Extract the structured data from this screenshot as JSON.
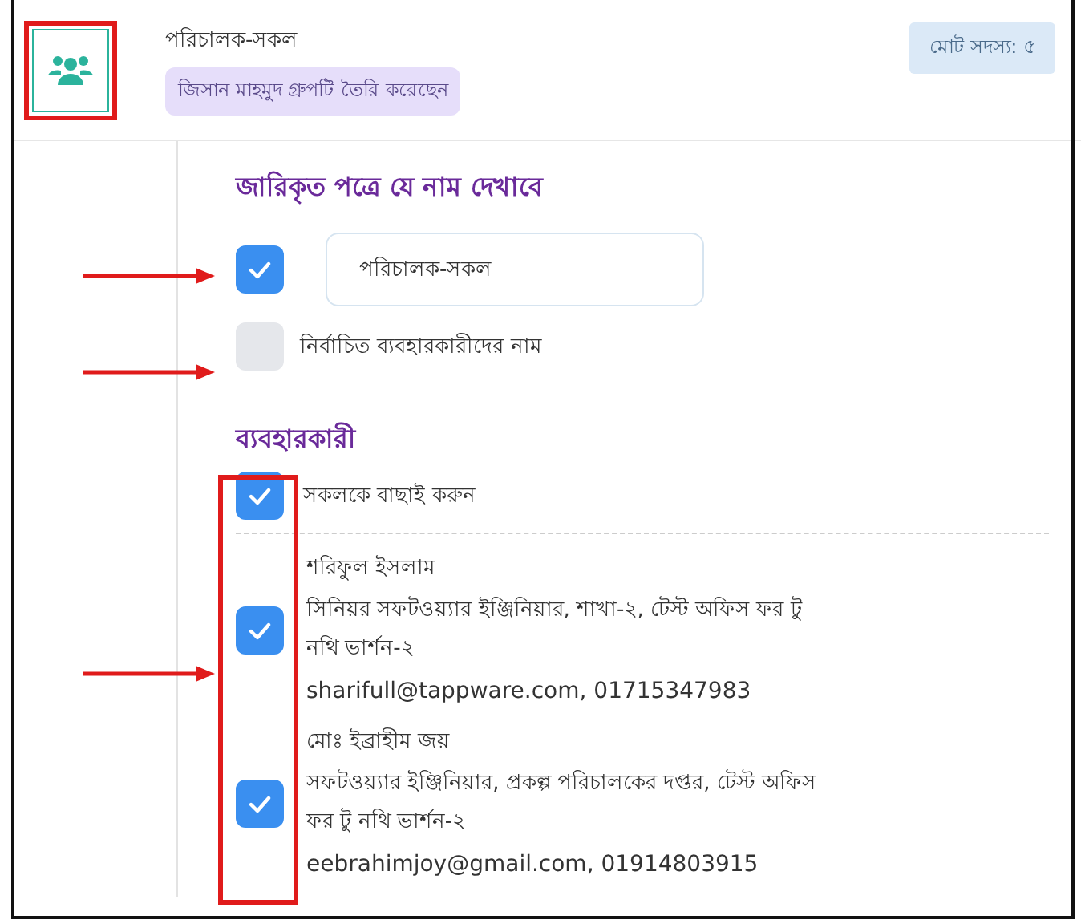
{
  "group": {
    "title": "পরিচালক-সকল",
    "created_by": "জিসান মাহমুদ গ্রুপটি তৈরি করেছেন",
    "member_count": "মোট সদস্য: ৫"
  },
  "display_name": {
    "heading": "জারিকৃত পত্রে যে নাম দেখাবে",
    "options": [
      {
        "kind": "field",
        "checked": true,
        "value": "পরিচালক-সকল"
      },
      {
        "kind": "label",
        "checked": false,
        "label": "নির্বাচিত ব্যবহারকারীদের নাম"
      }
    ]
  },
  "users": {
    "heading": "ব্যবহারকারী",
    "select_all": {
      "label": "সকলকে বাছাই করুন",
      "checked": true
    },
    "items": [
      {
        "name": "শরিফুল ইসলাম",
        "designation": "সিনিয়র সফটওয়্যার ইঞ্জিনিয়ার, শাখা-২, টেস্ট অফিস ফর টু নথি ভার্শন-২",
        "contact": "sharifull@tappware.com, 01715347983",
        "checked": true
      },
      {
        "name": "মোঃ ইব্রাহীম জয়",
        "designation": "সফটওয়্যার ইঞ্জিনিয়ার, প্রকল্প পরিচালকের দপ্তর, টেস্ট অফিস ফর টু নথি ভার্শন-২",
        "contact": "eebrahimjoy@gmail.com, 01914803915",
        "checked": true
      }
    ]
  }
}
